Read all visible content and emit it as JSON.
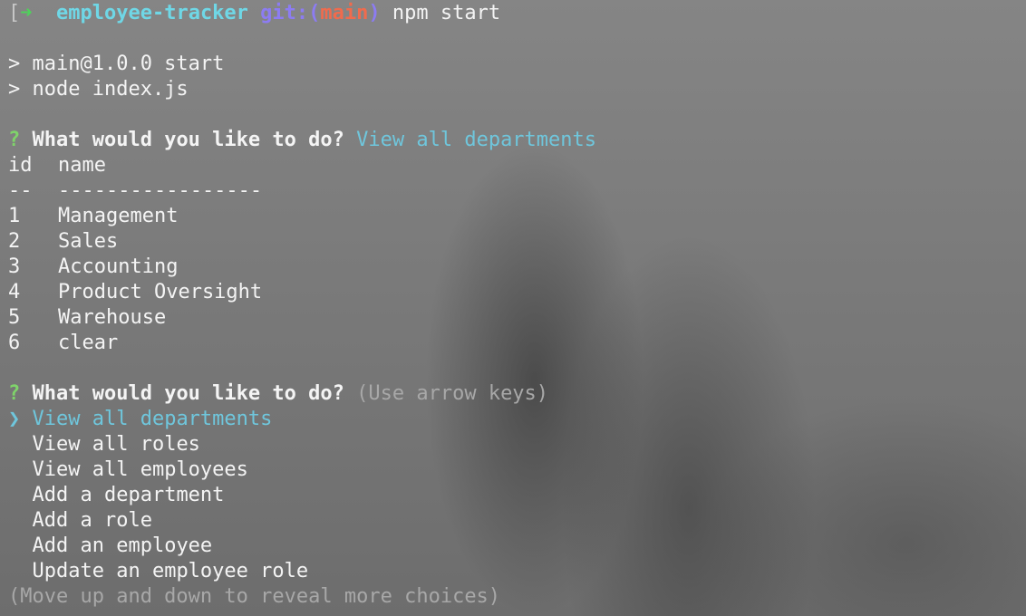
{
  "prompt": {
    "bracket": "[",
    "arrow": "➜",
    "directory": "employee-tracker",
    "git_prefix": "git:(",
    "branch": "main",
    "git_suffix": ")",
    "command": "npm start"
  },
  "npm_output": [
    "> main@1.0.0 start",
    "> node index.js"
  ],
  "first_question": {
    "mark": "?",
    "text": "What would you like to do?",
    "answer": "View all departments"
  },
  "table": {
    "headers": [
      "id",
      "name"
    ],
    "separators": [
      "--",
      "-----------------"
    ],
    "rows": [
      {
        "id": "1",
        "name": "Management"
      },
      {
        "id": "2",
        "name": "Sales"
      },
      {
        "id": "3",
        "name": "Accounting"
      },
      {
        "id": "4",
        "name": "Product Oversight"
      },
      {
        "id": "5",
        "name": "Warehouse"
      },
      {
        "id": "6",
        "name": "clear"
      }
    ]
  },
  "second_question": {
    "mark": "?",
    "text": "What would you like to do?",
    "hint": "(Use arrow keys)"
  },
  "choices": {
    "pointer": "❯",
    "items": [
      "View all departments",
      "View all roles",
      "View all employees",
      "Add a department",
      "Add a role",
      "Add an employee",
      "Update an employee role"
    ],
    "selected_index": 0
  },
  "footer_hint": "(Move up and down to reveal more choices)",
  "colors": {
    "green": "#4fd15b",
    "cyan": "#6fd7e6",
    "purple": "#8c7cf2",
    "red": "#f06b4d",
    "selected": "#6fc6dc",
    "dim": "#a8a8a8"
  }
}
